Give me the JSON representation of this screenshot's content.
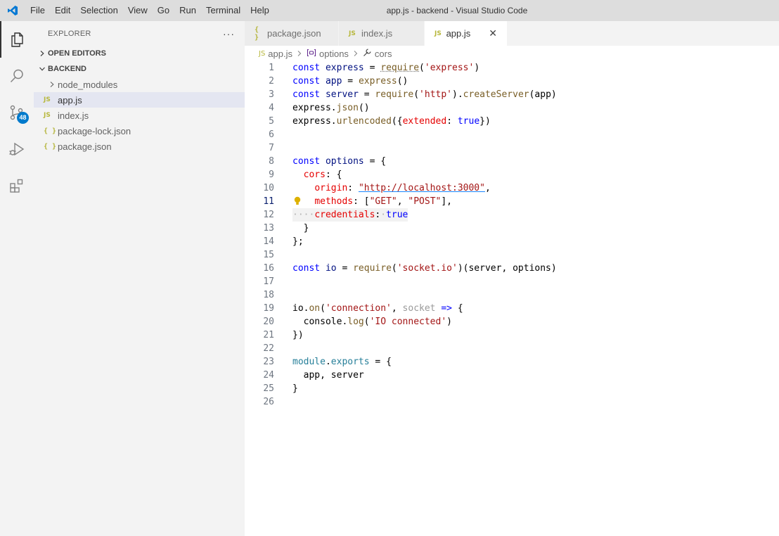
{
  "window": {
    "title": "app.js - backend - Visual Studio Code"
  },
  "menu": [
    "File",
    "Edit",
    "Selection",
    "View",
    "Go",
    "Run",
    "Terminal",
    "Help"
  ],
  "activity": {
    "scm_badge": "48"
  },
  "sidebar": {
    "title": "EXPLORER",
    "more": "···",
    "open_editors": "OPEN EDITORS",
    "folder": "BACKEND",
    "items": [
      {
        "label": "node_modules",
        "type": "folder"
      },
      {
        "label": "app.js",
        "type": "js"
      },
      {
        "label": "index.js",
        "type": "js"
      },
      {
        "label": "package-lock.json",
        "type": "json"
      },
      {
        "label": "package.json",
        "type": "json"
      }
    ]
  },
  "tabs": [
    {
      "label": "package.json",
      "icon": "{ }"
    },
    {
      "label": "index.js",
      "icon": "JS"
    },
    {
      "label": "app.js",
      "icon": "JS",
      "close": "✕"
    }
  ],
  "breadcrumb": {
    "file": "app.js",
    "symbol1": "options",
    "symbol2": "cors"
  },
  "icons": {
    "js": "JS",
    "json": "{ }"
  },
  "colors": {
    "accent": "#007acc",
    "keyword": "#0000ff",
    "string": "#a31515"
  },
  "line_numbers": [
    "1",
    "2",
    "3",
    "4",
    "5",
    "6",
    "7",
    "8",
    "9",
    "10",
    "11",
    "12",
    "13",
    "14",
    "15",
    "16",
    "17",
    "18",
    "19",
    "20",
    "21",
    "22",
    "23",
    "24",
    "25",
    "26"
  ],
  "code": {
    "l1a": "const",
    "l1b": "express",
    "l1c": " = ",
    "l1d": "require",
    "l1e": "(",
    "l1f": "'express'",
    "l1g": ")",
    "l2a": "const",
    "l2b": "app",
    "l2c": " = ",
    "l2d": "express",
    "l2e": "()",
    "l3a": "const",
    "l3b": "server",
    "l3c": " = ",
    "l3d": "require",
    "l3e": "(",
    "l3f": "'http'",
    "l3g": ").",
    "l3h": "createServer",
    "l3i": "(app)",
    "l4a": "express.",
    "l4b": "json",
    "l4c": "()",
    "l5a": "express.",
    "l5b": "urlencoded",
    "l5c": "({",
    "l5d": "extended",
    "l5e": ": ",
    "l5f": "true",
    "l5g": "})",
    "l8a": "const",
    "l8b": "options",
    "l8c": " = {",
    "l9a": "  ",
    "l9b": "cors",
    "l9c": ": {",
    "l10a": "    ",
    "l10b": "origin",
    "l10c": ": ",
    "l10d": "\"http://localhost:3000\"",
    "l10e": ",",
    "l11a": "    ",
    "l11b": "methods",
    "l11c": ": [",
    "l11d": "\"GET\"",
    "l11e": ", ",
    "l11f": "\"POST\"",
    "l11g": "],",
    "l12a": "····",
    "l12b": "credentials",
    "l12c": ":",
    "l12d": "·",
    "l12e": "true",
    "l13a": "  }",
    "l14a": "};",
    "l16a": "const",
    "l16b": "io",
    "l16c": " = ",
    "l16d": "require",
    "l16e": "(",
    "l16f": "'socket.io'",
    "l16g": ")(server, options)",
    "l19a": "io.",
    "l19b": "on",
    "l19c": "(",
    "l19d": "'connection'",
    "l19e": ", ",
    "l19f": "socket",
    "l19g": " => ",
    "l19h": "{",
    "l20a": "  console.",
    "l20b": "log",
    "l20c": "(",
    "l20d": "'IO connected'",
    "l20e": ")",
    "l21a": "})",
    "l23a": "module",
    "l23b": ".",
    "l23c": "exports",
    "l23d": " = {",
    "l24a": "  app, server",
    "l25a": "}"
  }
}
